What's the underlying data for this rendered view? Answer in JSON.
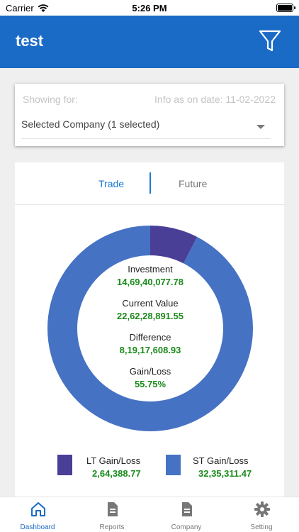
{
  "status_bar": {
    "carrier": "Carrier",
    "time": "5:26 PM"
  },
  "header": {
    "title": "test",
    "filter_icon": "filter-icon"
  },
  "filter": {
    "showing_label": "Showing for:",
    "info_date": "Info as on date: 11-02-2022",
    "selected_value": "Selected Company (1 selected)"
  },
  "tabs": [
    {
      "label": "Trade",
      "active": true
    },
    {
      "label": "Future",
      "active": false
    }
  ],
  "summary": {
    "investment_label": "Investment",
    "investment_value": "14,69,40,077.78",
    "current_label": "Current Value",
    "current_value": "22,62,28,891.55",
    "difference_label": "Difference",
    "difference_value": "8,19,17,608.93",
    "gain_label": "Gain/Loss",
    "gain_value": "55.75%"
  },
  "chart_data": {
    "type": "pie",
    "donut": true,
    "series": [
      {
        "name": "LT Gain/Loss",
        "value": 264388.77,
        "color": "#4a3f97"
      },
      {
        "name": "ST Gain/Loss",
        "value": 3235311.47,
        "color": "#4672c4"
      }
    ],
    "legend": [
      {
        "label": "LT Gain/Loss",
        "value": "2,64,388.77",
        "color": "#4a3f97"
      },
      {
        "label": "ST Gain/Loss",
        "value": "32,35,311.47",
        "color": "#4672c4"
      }
    ]
  },
  "bottom_nav": [
    {
      "label": "Dashboard",
      "icon": "home-icon",
      "active": true
    },
    {
      "label": "Reports",
      "icon": "document-icon",
      "active": false
    },
    {
      "label": "Company",
      "icon": "document-icon",
      "active": false
    },
    {
      "label": "Setting",
      "icon": "gear-icon",
      "active": false
    }
  ],
  "colors": {
    "primary": "#1a6bc6",
    "gain_text": "#1b8a1b",
    "lt_color": "#4a3f97",
    "st_color": "#4672c4"
  }
}
